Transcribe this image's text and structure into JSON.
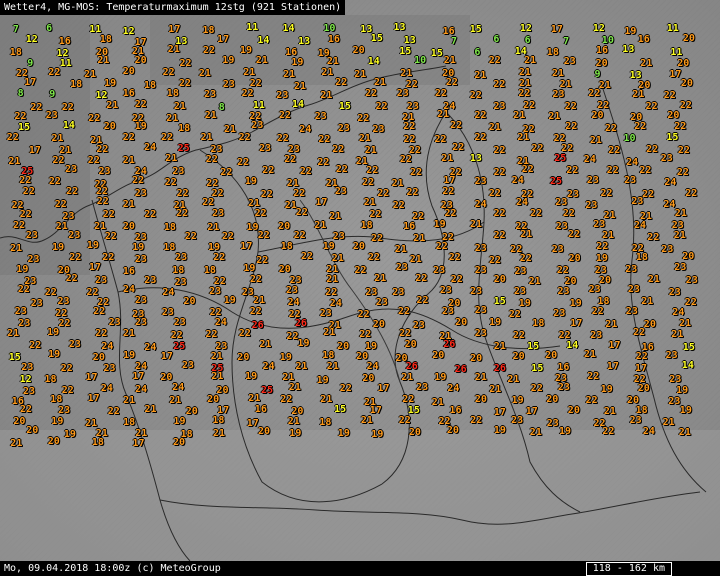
{
  "header": {
    "title": "Wetter4, MG-MOS: Temperaturmaximum 12stg (921 Stationen)"
  },
  "footer": {
    "left_text": "Mo, 09.04.2018 18:00z (c) MeteoGroup",
    "scale_text": "118 - 162 km"
  },
  "colors": {
    "background": "#8e8e8e",
    "border_line": "#2a2a2a",
    "cool_green": "#7fe84a",
    "mild_yellow": "#ffff22",
    "warm_orange": "#ff9a1a",
    "hot_red": "#ff2a1a",
    "bar_bg": "#000000",
    "bar_text": "#ffffff"
  },
  "color_scale": [
    {
      "max": 10,
      "color": "#7fe84a"
    },
    {
      "max": 15,
      "color": "#ffff22"
    },
    {
      "max": 24,
      "color": "#ff9a1a"
    },
    {
      "max": 99,
      "color": "#ff2a1a"
    }
  ],
  "station_values": [
    7,
    6,
    11,
    12,
    17,
    18,
    11,
    14,
    10,
    13,
    13,
    16,
    15,
    12,
    17,
    12,
    19,
    11,
    12,
    16,
    18,
    17,
    13,
    17,
    14,
    13,
    16,
    15,
    13,
    7,
    6,
    6,
    7,
    10,
    16,
    20,
    18,
    12,
    20,
    21,
    21,
    22,
    19,
    16,
    19,
    20,
    15,
    15,
    6,
    14,
    18,
    16,
    13,
    11,
    9,
    11,
    21,
    20,
    22,
    19,
    21,
    19,
    21,
    14,
    10,
    21,
    22,
    21,
    23,
    20,
    21,
    20,
    22,
    22,
    21,
    20,
    22,
    21,
    21,
    21,
    21,
    21,
    21,
    20,
    21,
    21,
    21,
    9,
    13,
    17,
    17,
    18,
    19,
    18,
    22,
    23,
    22,
    21,
    22,
    21,
    22,
    22,
    22,
    21,
    21,
    21,
    20,
    20,
    8,
    9,
    12,
    16,
    18,
    23,
    22,
    23,
    21,
    22,
    23,
    22,
    22,
    22,
    23,
    22,
    21,
    22,
    22,
    22,
    21,
    22,
    21,
    8,
    11,
    14,
    15,
    22,
    23,
    24,
    23,
    22,
    22,
    22,
    22,
    22,
    22,
    23,
    22,
    22,
    21,
    21,
    22,
    22,
    23,
    22,
    21,
    21,
    22,
    21,
    21,
    20,
    20,
    20,
    15,
    14,
    20,
    19,
    18,
    21,
    23,
    24,
    23,
    23,
    22,
    22,
    21,
    22,
    22,
    22,
    22,
    22,
    22,
    21,
    21,
    22,
    22,
    21,
    22,
    22,
    22,
    21,
    22,
    22,
    22,
    21,
    22,
    21,
    10,
    15,
    17,
    21,
    22,
    24,
    25,
    23,
    23,
    23,
    22,
    21,
    22,
    22,
    22,
    22,
    22,
    22,
    22,
    22,
    21,
    22,
    22,
    21,
    21,
    22,
    22,
    22,
    22,
    21,
    22,
    21,
    13,
    21,
    25,
    24,
    24,
    23,
    25,
    23,
    23,
    24,
    23,
    22,
    22,
    22,
    22,
    22,
    22,
    22,
    22,
    22,
    22,
    22,
    22,
    22,
    22,
    22,
    22,
    22,
    22,
    22,
    19,
    21,
    21,
    22,
    21,
    17,
    23,
    24,
    25,
    23,
    23,
    24,
    22,
    22,
    22,
    23,
    22,
    22,
    22,
    22,
    23,
    22,
    22,
    22,
    22,
    22,
    23,
    22,
    22,
    22,
    22,
    22,
    22,
    21,
    21,
    22,
    21,
    21,
    17,
    21,
    22,
    23,
    24,
    24,
    23,
    23,
    23,
    24,
    22,
    23,
    22,
    22,
    22,
    23,
    22,
    22,
    21,
    22,
    22,
    22,
    22,
    22,
    22,
    21,
    21,
    21,
    22,
    21,
    21,
    20,
    18,
    21,
    19,
    20,
    21,
    18,
    16,
    19,
    21,
    22,
    23,
    23,
    24,
    23,
    23,
    23,
    22,
    23,
    22,
    22,
    22,
    22,
    23,
    22,
    21,
    22,
    22,
    21,
    22,
    21,
    22,
    21,
    21,
    19,
    19,
    19,
    18,
    19,
    17,
    18,
    19,
    20,
    21,
    22,
    23,
    22,
    23,
    22,
    22,
    23,
    23,
    22,
    22,
    23,
    23,
    22,
    22,
    22,
    21,
    22,
    21,
    22,
    22,
    22,
    20,
    19,
    18,
    20,
    19,
    20,
    17,
    16,
    18,
    18,
    19,
    20,
    21,
    22,
    23,
    23,
    23,
    23,
    22,
    23,
    23,
    23,
    23,
    22,
    23,
    23,
    23,
    22,
    22,
    23,
    21,
    21,
    22,
    22,
    20,
    21,
    20,
    20,
    21,
    23,
    22,
    22,
    22,
    24,
    24,
    23,
    23,
    23,
    22,
    23,
    23,
    23,
    23,
    23,
    23,
    23,
    23,
    23,
    23,
    23,
    22,
    23,
    20,
    19,
    21,
    24,
    24,
    23,
    22,
    20,
    15,
    19,
    19,
    18,
    21,
    22,
    23,
    22,
    22,
    23,
    23,
    22,
    22,
    22,
    23,
    22,
    22,
    23,
    23,
    22,
    23,
    22,
    23,
    24,
    23,
    22,
    23,
    23,
    23,
    24,
    26,
    26,
    21,
    20,
    23,
    20,
    19,
    18,
    17,
    21,
    20,
    21,
    21,
    19,
    22,
    21,
    22,
    22,
    22,
    22,
    21,
    22,
    22,
    21,
    23,
    22,
    22,
    23,
    22,
    21,
    22,
    23,
    24,
    24,
    25,
    23,
    21,
    19,
    20,
    19,
    20,
    26,
    21,
    15,
    14,
    17,
    16,
    15,
    15,
    19,
    20,
    19,
    17,
    21,
    20,
    19,
    18,
    20,
    20,
    20,
    20,
    20,
    20,
    21,
    22,
    23,
    23,
    22,
    23,
    24,
    23,
    25,
    24,
    21,
    21,
    24,
    26,
    26,
    26,
    15,
    16,
    17,
    17,
    14,
    12,
    18,
    17,
    17,
    20,
    21,
    19,
    21,
    19,
    20,
    21,
    19,
    21,
    21,
    23,
    22,
    22,
    23,
    23,
    22,
    24,
    24,
    24,
    20,
    25,
    21,
    22,
    17,
    23,
    24,
    21,
    22,
    23,
    19,
    20,
    19,
    16,
    18,
    17,
    21,
    21,
    20,
    21,
    22,
    21,
    21,
    22,
    21,
    20,
    19,
    20,
    22,
    20,
    23,
    22,
    23,
    22,
    21,
    20,
    17,
    16,
    20,
    15,
    17,
    15,
    16,
    17,
    17,
    20,
    21,
    18,
    19,
    20,
    19,
    21,
    18,
    19,
    18,
    17,
    21,
    18,
    21,
    22,
    22,
    22,
    23,
    23,
    22,
    23,
    21,
    20,
    19,
    21,
    21,
    18,
    21,
    20,
    19,
    19,
    19,
    20,
    20,
    19,
    21,
    19,
    22,
    24,
    21,
    21,
    20,
    18,
    17,
    20
  ]
}
